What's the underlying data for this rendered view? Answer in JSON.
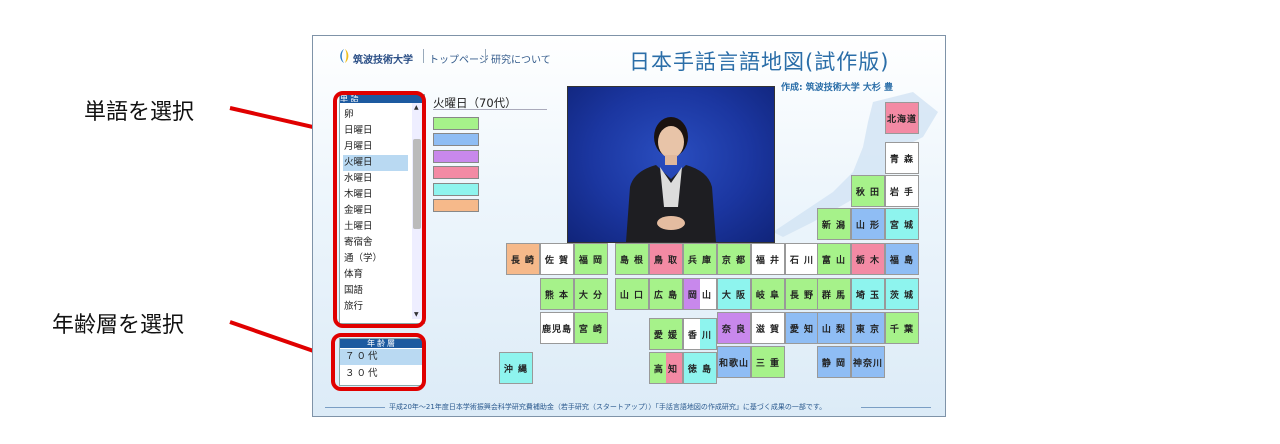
{
  "annotations": {
    "word_select": "単語を選択",
    "age_select": "年齢層を選択"
  },
  "header": {
    "university": "筑波技術大学",
    "nav_top": "トップページ",
    "nav_research": "研究について",
    "title": "日本手話言語地図(試作版)",
    "author": "作成: 筑波技術大学 大杉 豊"
  },
  "word_list": {
    "header": "単 語",
    "items": [
      "卵",
      "日曜日",
      "月曜日",
      "火曜日",
      "水曜日",
      "木曜日",
      "金曜日",
      "土曜日",
      "寄宿舎",
      "通（学）",
      "体育",
      "国語",
      "旅行"
    ],
    "selected": "火曜日"
  },
  "age_list": {
    "header": "年齢層",
    "items": [
      "７０代",
      "３０代"
    ],
    "selected": "７０代"
  },
  "legend": {
    "current": "火曜日（70代）",
    "colors": [
      "#a6f28a",
      "#8fbdf4",
      "#c888ec",
      "#f38aa4",
      "#8ef4ee",
      "#f6b98a"
    ]
  },
  "prefectures": [
    {
      "name": "北海道",
      "color": "#f38aa4"
    },
    {
      "name": "青 森",
      "color": "#ffffff"
    },
    {
      "name": "秋 田",
      "color": "#a6f28a"
    },
    {
      "name": "岩 手",
      "color": "#ffffff"
    },
    {
      "name": "新 潟",
      "color": "#a6f28a"
    },
    {
      "name": "山 形",
      "color": "#8fbdf4"
    },
    {
      "name": "宮 城",
      "color": "#8ef4ee"
    },
    {
      "name": "長 崎",
      "color": "#f6b98a"
    },
    {
      "name": "佐 賀",
      "color": "#ffffff"
    },
    {
      "name": "福 岡",
      "color": "#a6f28a"
    },
    {
      "name": "島 根",
      "color": "#a6f28a"
    },
    {
      "name": "鳥 取",
      "color": "#f38aa4"
    },
    {
      "name": "兵 庫",
      "color": "#a6f28a"
    },
    {
      "name": "京 都",
      "color": "#a6f28a"
    },
    {
      "name": "福 井",
      "color": "#ffffff"
    },
    {
      "name": "石 川",
      "color": "#ffffff"
    },
    {
      "name": "富 山",
      "color": "#a6f28a"
    },
    {
      "name": "栃 木",
      "color": "#f38aa4"
    },
    {
      "name": "福 島",
      "color": "#8fbdf4"
    },
    {
      "name": "熊 本",
      "color": "#a6f28a"
    },
    {
      "name": "大 分",
      "color": "#a6f28a"
    },
    {
      "name": "山 口",
      "color": "#a6f28a"
    },
    {
      "name": "広 島",
      "color": "#a6f28a"
    },
    {
      "name": "岡 山",
      "color": "#c888ec"
    },
    {
      "name": "大 阪",
      "color": "#8ef4ee"
    },
    {
      "name": "岐 阜",
      "color": "#a6f28a"
    },
    {
      "name": "長 野",
      "color": "#a6f28a"
    },
    {
      "name": "群 馬",
      "color": "#a6f28a"
    },
    {
      "name": "埼 玉",
      "color": "#8ef4ee"
    },
    {
      "name": "茨 城",
      "color": "#8ef4ee"
    },
    {
      "name": "鹿児島",
      "color": "#ffffff"
    },
    {
      "name": "宮 崎",
      "color": "#a6f28a"
    },
    {
      "name": "愛 媛",
      "color": "#a6f28a"
    },
    {
      "name": "香 川",
      "color": "#ffffff"
    },
    {
      "name": "奈 良",
      "color": "#c888ec"
    },
    {
      "name": "滋 賀",
      "color": "#ffffff"
    },
    {
      "name": "愛 知",
      "color": "#8fbdf4"
    },
    {
      "name": "山 梨",
      "color": "#8fbdf4"
    },
    {
      "name": "東 京",
      "color": "#8fbdf4"
    },
    {
      "name": "千 葉",
      "color": "#a6f28a"
    },
    {
      "name": "沖 縄",
      "color": "#8ef4ee"
    },
    {
      "name": "高 知",
      "color": "#a6f28a"
    },
    {
      "name": "徳 島",
      "color": "#8ef4ee"
    },
    {
      "name": "和歌山",
      "color": "#8fbdf4"
    },
    {
      "name": "三 重",
      "color": "#a6f28a"
    },
    {
      "name": "静 岡",
      "color": "#8fbdf4"
    },
    {
      "name": "神奈川",
      "color": "#8fbdf4"
    }
  ],
  "footer": "平成20年～21年度日本学術振興会科学研究費補助金（若手研究（スタートアップ））「手話言語地図の作成研究」に基づく成果の一部です。"
}
